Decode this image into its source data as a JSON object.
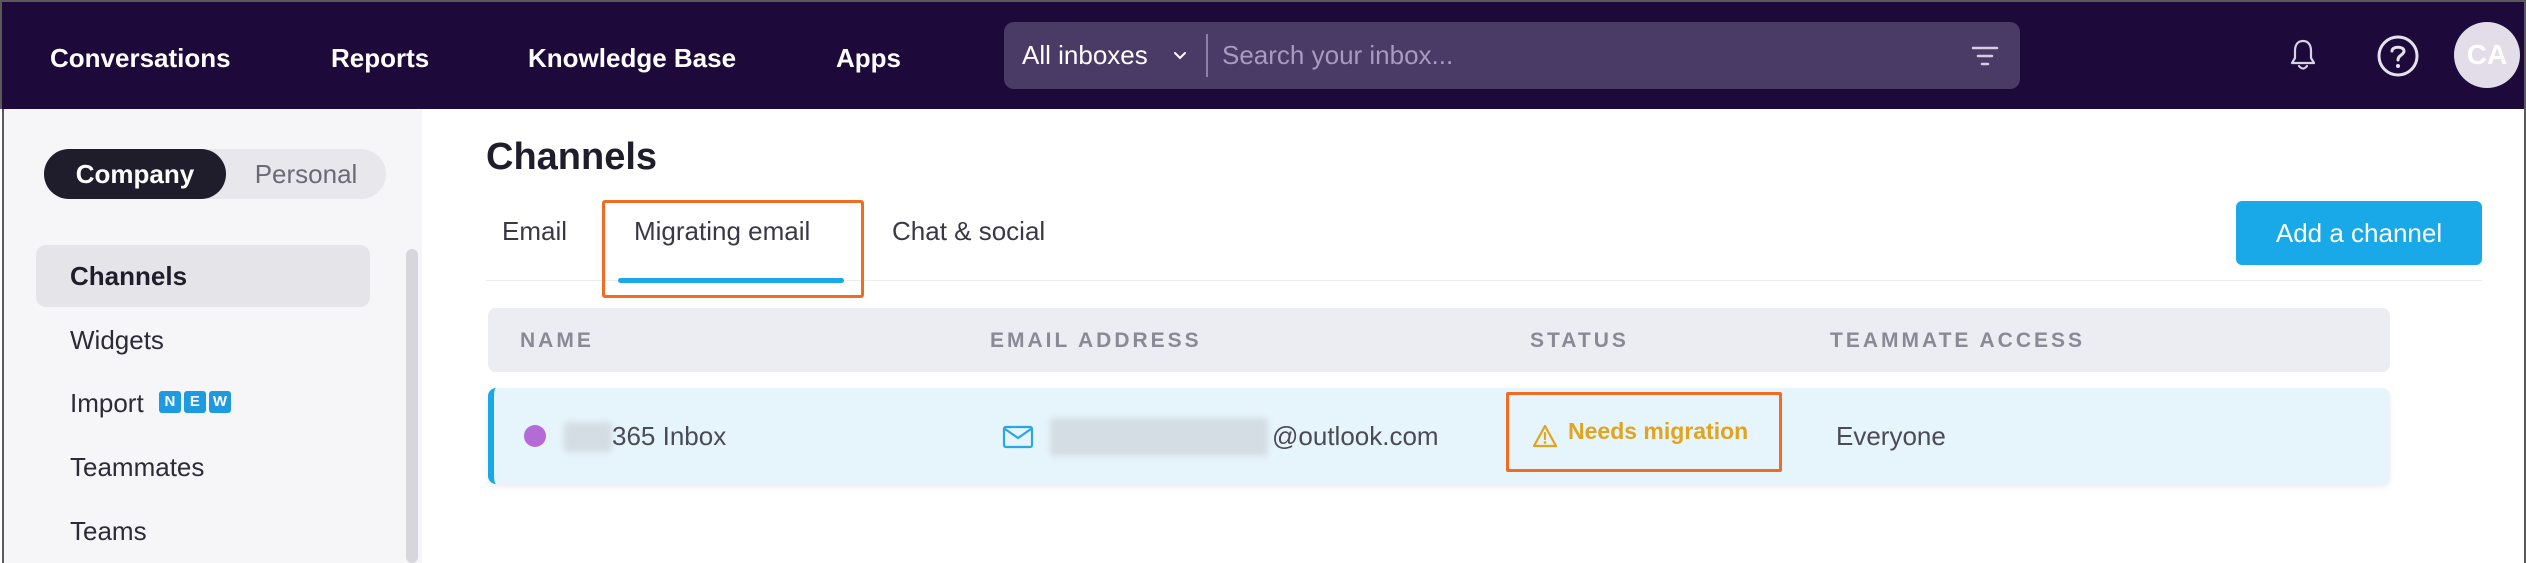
{
  "nav": {
    "items": [
      "Conversations",
      "Reports",
      "Knowledge Base",
      "Apps"
    ],
    "inbox_select": "All inboxes",
    "search_placeholder": "Search your inbox...",
    "avatar_initials": "CA"
  },
  "sidebar": {
    "segment": {
      "active": "Company",
      "inactive": "Personal"
    },
    "items": [
      {
        "label": "Channels",
        "active": true
      },
      {
        "label": "Widgets"
      },
      {
        "label": "Import",
        "badge": [
          "N",
          "E",
          "W"
        ]
      },
      {
        "label": "Teammates"
      },
      {
        "label": "Teams"
      }
    ]
  },
  "main": {
    "title": "Channels",
    "tabs": [
      "Email",
      "Migrating email",
      "Chat & social"
    ],
    "active_tab": "Migrating email",
    "add_button": "Add a channel",
    "table": {
      "headers": [
        "NAME",
        "EMAIL ADDRESS",
        "STATUS",
        "TEAMMATE ACCESS"
      ],
      "rows": [
        {
          "name": "365 Inbox",
          "email": "@outlook.com",
          "status": "Needs migration",
          "access": "Everyone"
        }
      ]
    }
  },
  "colors": {
    "topbar": "#1d0a3a",
    "accent": "#1aa9e8",
    "highlight": "#f26b22",
    "warning": "#e0a41e",
    "inbox_dot": "#b46bd6"
  }
}
